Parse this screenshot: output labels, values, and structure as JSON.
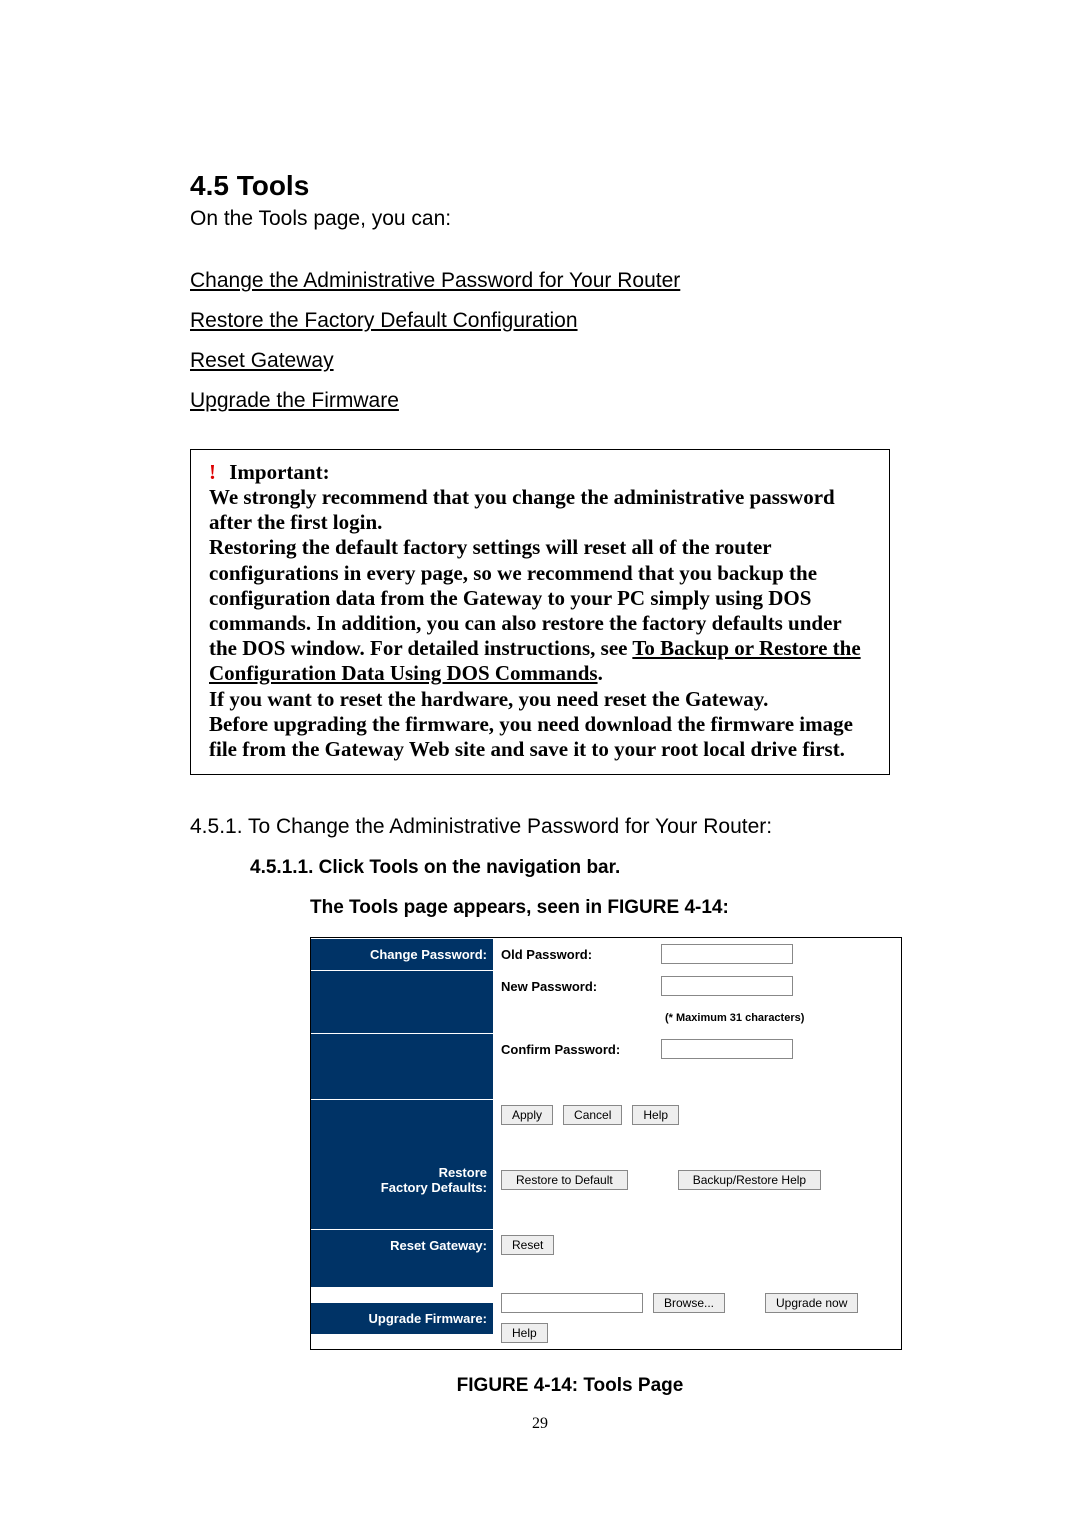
{
  "heading": "4.5 Tools",
  "intro": "On the Tools page, you can:",
  "links": {
    "change_pw": "Change the Administrative Password for Your Router",
    "restore": "Restore the Factory Default Configuration",
    "reset": "Reset Gateway",
    "upgrade": "Upgrade the Firmware"
  },
  "important": {
    "title": "Important:",
    "p1": "We strongly recommend that you change the administrative password after the first login.",
    "p2a": "Restoring the default factory settings will reset all of the router configurations in every page, so we recommend that you backup the configuration data from the Gateway to your PC simply using DOS commands. In addition, you can also restore the factory defaults under the DOS window. For detailed instructions, see ",
    "p2link": "To Backup or Restore the Configuration Data Using DOS Commands",
    "p2b": ".",
    "p3": "If you want to reset the hardware, you need reset the Gateway.",
    "p4": "Before upgrading the firmware, you need download the firmware image file from the Gateway Web site and save it to your root local drive first."
  },
  "subheading": "4.5.1. To Change the Administrative Password for Your Router:",
  "step": "4.5.1.1. Click Tools on the navigation bar.",
  "fig_lead": "The Tools page appears, seen in FIGURE 4-14:",
  "screenshot": {
    "change_password_label": "Change Password:",
    "old_password": "Old Password:",
    "new_password": "New Password:",
    "confirm_password": "Confirm Password:",
    "max_hint": "(* Maximum 31 characters)",
    "apply": "Apply",
    "cancel": "Cancel",
    "help": "Help",
    "restore_label_line1": "Restore",
    "restore_label_line2": "Factory Defaults:",
    "restore_btn": "Restore to Default",
    "backup_btn": "Backup/Restore Help",
    "reset_label": "Reset Gateway:",
    "reset_btn": "Reset",
    "upgrade_label": "Upgrade Firmware:",
    "browse_btn": "Browse...",
    "upgrade_btn": "Upgrade now",
    "help_btn": "Help"
  },
  "fig_caption": "FIGURE 4-14: Tools Page",
  "page_number": "29"
}
